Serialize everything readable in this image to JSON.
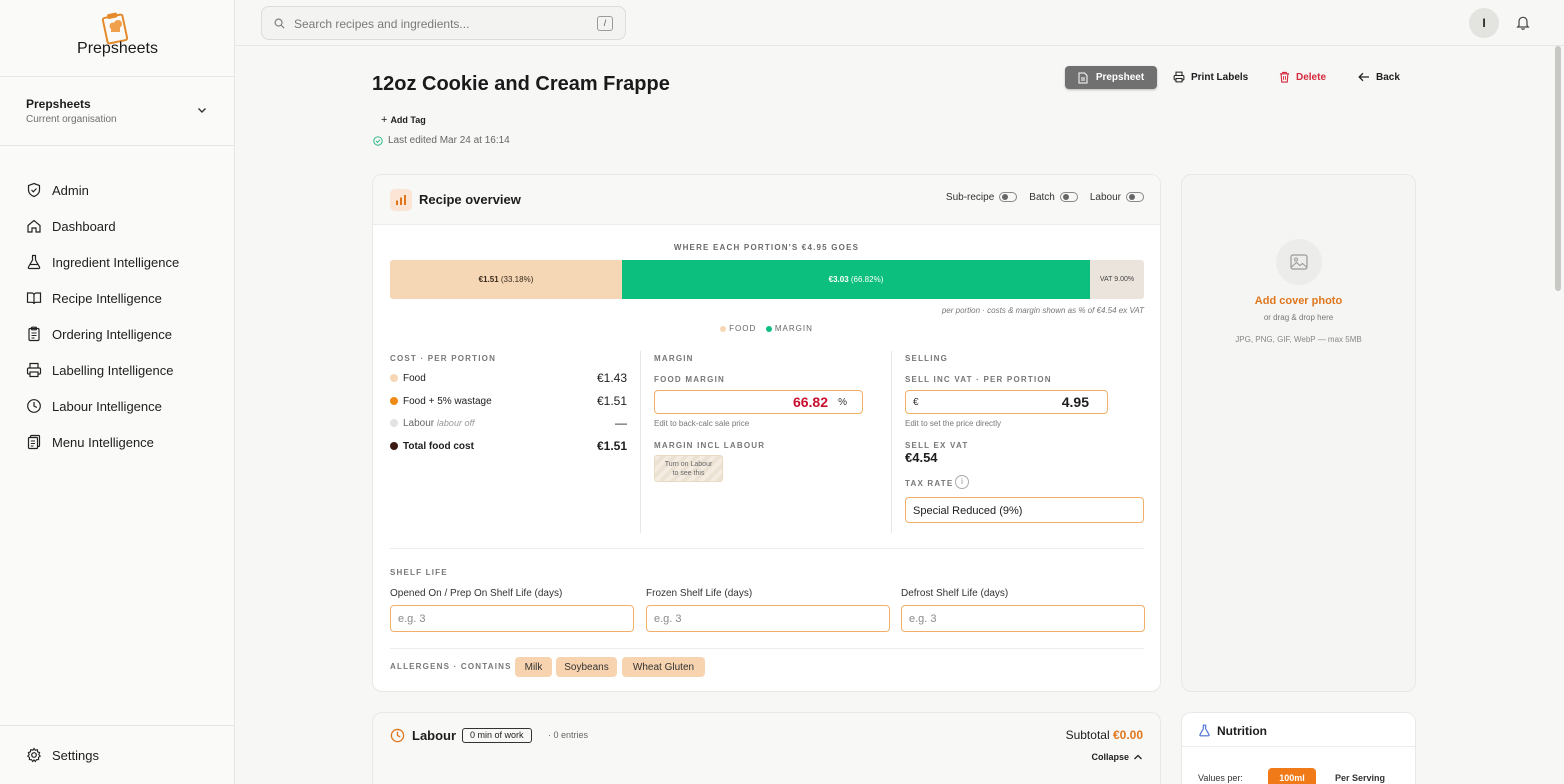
{
  "app": {
    "name": "Prepsheets"
  },
  "org": {
    "name": "Prepsheets",
    "subtitle": "Current organisation"
  },
  "nav": {
    "items": [
      {
        "label": "Admin",
        "icon": "shield-icon"
      },
      {
        "label": "Dashboard",
        "icon": "home-icon"
      },
      {
        "label": "Ingredient Intelligence",
        "icon": "flask-icon"
      },
      {
        "label": "Recipe Intelligence",
        "icon": "book-icon"
      },
      {
        "label": "Ordering Intelligence",
        "icon": "clipboard-icon"
      },
      {
        "label": "Labelling Intelligence",
        "icon": "printer-icon"
      },
      {
        "label": "Labour Intelligence",
        "icon": "clock-icon"
      },
      {
        "label": "Menu Intelligence",
        "icon": "menu-icon"
      }
    ],
    "settings": "Settings"
  },
  "search": {
    "placeholder": "Search recipes and ingredients...",
    "shortcut": "/"
  },
  "user": {
    "initial": "I"
  },
  "recipe": {
    "title": "12oz Cookie and Cream Frappe",
    "add_tag": "Add Tag",
    "last_edited": "Last edited Mar 24 at 16:14"
  },
  "actions": {
    "prepsheet": "Prepsheet",
    "print_labels": "Print Labels",
    "delete": "Delete",
    "back": "Back"
  },
  "overview": {
    "title": "Recipe overview",
    "toggles": [
      {
        "label": "Sub-recipe",
        "on": false
      },
      {
        "label": "Batch",
        "on": false
      },
      {
        "label": "Labour",
        "on": false
      }
    ],
    "where_title": "WHERE EACH PORTION'S €4.95 GOES",
    "breakdown": [
      {
        "value": "€1.51",
        "pct": "(33.18%)",
        "share": 0.3318,
        "color": "#f5d7b6"
      },
      {
        "value": "€3.03",
        "pct": "(66.82%)",
        "share": 0.6682,
        "color": "#0dbf7e"
      }
    ],
    "vat_label": "VAT 9.00%",
    "vat_share": 0.09,
    "bar_note": "per portion · costs & margin shown as % of €4.54 ex VAT",
    "legend": [
      {
        "label": "FOOD",
        "color": "#f5d7b6"
      },
      {
        "label": "MARGIN",
        "color": "#0dbf7e"
      }
    ]
  },
  "cost": {
    "heading": "COST · PER PORTION",
    "rows": [
      {
        "label": "Food",
        "value": "€1.43",
        "dot": "#f5d7b6"
      },
      {
        "label": "Food + 5% wastage",
        "value": "€1.51",
        "dot": "#ef8a17"
      },
      {
        "label": "Labour",
        "note": "labour off",
        "value": "—",
        "dot": "#e2e2e0"
      },
      {
        "label": "Total food cost",
        "value": "€1.51",
        "dot": "#3a1a12"
      }
    ]
  },
  "margin": {
    "heading": "MARGIN",
    "food_margin_label": "FOOD MARGIN",
    "food_margin_value": "66.82",
    "food_margin_unit": "%",
    "food_margin_hint": "Edit to back-calc sale price",
    "incl_labour_label": "MARGIN INCL LABOUR",
    "incl_labour_note_1": "Turn on Labour",
    "incl_labour_note_2": "to see this"
  },
  "selling": {
    "heading": "SELLING",
    "inc_vat_label": "SELL INC VAT · PER PORTION",
    "currency": "€",
    "inc_vat_value": "4.95",
    "inc_vat_hint": "Edit to set the price directly",
    "ex_vat_label": "SELL EX VAT",
    "ex_vat_value": "€4.54",
    "tax_label": "TAX RATE",
    "tax_value": "Special Reduced (9%)"
  },
  "shelf": {
    "heading": "SHELF LIFE",
    "fields": [
      {
        "label": "Opened On / Prep On Shelf Life (days)",
        "placeholder": "e.g. 3"
      },
      {
        "label": "Frozen Shelf Life (days)",
        "placeholder": "e.g. 3"
      },
      {
        "label": "Defrost Shelf Life (days)",
        "placeholder": "e.g. 3"
      }
    ]
  },
  "allergens": {
    "heading": "ALLERGENS · CONTAINS",
    "items": [
      "Milk",
      "Soybeans",
      "Wheat Gluten"
    ]
  },
  "photo": {
    "add": "Add cover photo",
    "sub": "or drag & drop here",
    "formats": "JPG, PNG, GIF, WebP — max 5MB"
  },
  "labour": {
    "title": "Labour",
    "badge": "0 min of work",
    "entries": "· 0 entries",
    "subtotal_label": "Subtotal",
    "subtotal_value": "€0.00",
    "collapse": "Collapse"
  },
  "nutrition": {
    "title": "Nutrition",
    "values_per": "Values per:",
    "options": [
      "100ml",
      "Per Serving"
    ],
    "selected": "100ml"
  },
  "colors": {
    "accent": "#e0761c",
    "delete": "#d6283b",
    "margin_green": "#0dbf7e",
    "margin_text": "#c8102e"
  }
}
